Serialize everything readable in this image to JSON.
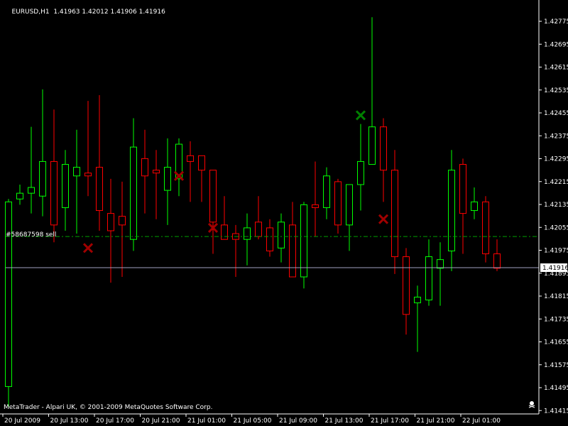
{
  "window": {
    "title_parts": [
      "EURUSD,H1",
      "1.41963",
      "1.42012",
      "1.41906",
      "1.41916"
    ],
    "copyright": "MetaTrader - Alpari UK, © 2001-2009 MetaQuotes Software Corp.",
    "order_label": "#58687598 sell",
    "current_price_label": "1.41916"
  },
  "colors": {
    "background": "#000000",
    "axis": "#ffffff",
    "bull": "#00ff00",
    "bear": "#ff0000",
    "bull_marker": "#008000",
    "bear_marker": "#a00000",
    "order_line": "#00a000",
    "price_line": "#a0a0c0"
  },
  "chart_data": {
    "type": "candlestick",
    "symbol": "EURUSD",
    "timeframe": "H1",
    "ylim": [
      1.4141,
      1.4282
    ],
    "y_ticks": [
      "1.42775",
      "1.42695",
      "1.42615",
      "1.42535",
      "1.42455",
      "1.42375",
      "1.42295",
      "1.42215",
      "1.42135",
      "1.42055",
      "1.41975",
      "1.41895",
      "1.41815",
      "1.41735",
      "1.41655",
      "1.41575",
      "1.41495",
      "1.41415"
    ],
    "x_tick_labels": [
      "20 Jul 2009",
      "20 Jul 13:00",
      "20 Jul 17:00",
      "20 Jul 21:00",
      "21 Jul 01:00",
      "21 Jul 05:00",
      "21 Jul 09:00",
      "21 Jul 13:00",
      "21 Jul 17:00",
      "21 Jul 21:00",
      "22 Jul 01:00"
    ],
    "candles": [
      {
        "o": 1.415,
        "h": 1.4215,
        "l": 1.4143,
        "c": 1.4214
      },
      {
        "o": 1.4215,
        "h": 1.422,
        "l": 1.4213,
        "c": 1.4217
      },
      {
        "o": 1.4217,
        "h": 1.424,
        "l": 1.421,
        "c": 1.4219
      },
      {
        "o": 1.4216,
        "h": 1.4253,
        "l": 1.4209,
        "c": 1.4228
      },
      {
        "o": 1.4228,
        "h": 1.4246,
        "l": 1.42,
        "c": 1.4206
      },
      {
        "o": 1.4212,
        "h": 1.4232,
        "l": 1.4204,
        "c": 1.4227
      },
      {
        "o": 1.4223,
        "h": 1.4239,
        "l": 1.4203,
        "c": 1.4226
      },
      {
        "o": 1.4224,
        "h": 1.4249,
        "l": 1.4216,
        "c": 1.4223
      },
      {
        "o": 1.4226,
        "h": 1.4251,
        "l": 1.4204,
        "c": 1.4211
      },
      {
        "o": 1.421,
        "h": 1.4222,
        "l": 1.4186,
        "c": 1.4204
      },
      {
        "o": 1.4209,
        "h": 1.4221,
        "l": 1.4188,
        "c": 1.4206
      },
      {
        "o": 1.4201,
        "h": 1.4243,
        "l": 1.4197,
        "c": 1.4233
      },
      {
        "o": 1.4229,
        "h": 1.4239,
        "l": 1.421,
        "c": 1.4223
      },
      {
        "o": 1.4225,
        "h": 1.4232,
        "l": 1.4208,
        "c": 1.4224
      },
      {
        "o": 1.4218,
        "h": 1.4236,
        "l": 1.4206,
        "c": 1.4226
      },
      {
        "o": 1.4222,
        "h": 1.4236,
        "l": 1.4216,
        "c": 1.4234
      },
      {
        "o": 1.423,
        "h": 1.4235,
        "l": 1.4214,
        "c": 1.4228
      },
      {
        "o": 1.423,
        "h": 1.4226,
        "l": 1.4214,
        "c": 1.4225
      },
      {
        "o": 1.4225,
        "h": 1.4223,
        "l": 1.4196,
        "c": 1.4207
      },
      {
        "o": 1.4206,
        "h": 1.4216,
        "l": 1.4203,
        "c": 1.4201
      },
      {
        "o": 1.4203,
        "h": 1.4206,
        "l": 1.4188,
        "c": 1.4201
      },
      {
        "o": 1.4201,
        "h": 1.421,
        "l": 1.4192,
        "c": 1.4205
      },
      {
        "o": 1.4207,
        "h": 1.4216,
        "l": 1.4201,
        "c": 1.4202
      },
      {
        "o": 1.4205,
        "h": 1.4208,
        "l": 1.4195,
        "c": 1.4197
      },
      {
        "o": 1.4198,
        "h": 1.421,
        "l": 1.4193,
        "c": 1.4207
      },
      {
        "o": 1.4206,
        "h": 1.4214,
        "l": 1.419,
        "c": 1.4188
      },
      {
        "o": 1.4188,
        "h": 1.4214,
        "l": 1.4184,
        "c": 1.4213
      },
      {
        "o": 1.4213,
        "h": 1.4228,
        "l": 1.4202,
        "c": 1.4212
      },
      {
        "o": 1.4212,
        "h": 1.4226,
        "l": 1.4208,
        "c": 1.4223
      },
      {
        "o": 1.4221,
        "h": 1.4222,
        "l": 1.4203,
        "c": 1.4206
      },
      {
        "o": 1.4206,
        "h": 1.4218,
        "l": 1.4197,
        "c": 1.422
      },
      {
        "o": 1.422,
        "h": 1.4241,
        "l": 1.4211,
        "c": 1.4228
      },
      {
        "o": 1.4227,
        "h": 1.4278,
        "l": 1.4227,
        "c": 1.424
      },
      {
        "o": 1.424,
        "h": 1.4243,
        "l": 1.4214,
        "c": 1.4225
      },
      {
        "o": 1.4225,
        "h": 1.4232,
        "l": 1.4189,
        "c": 1.4195
      },
      {
        "o": 1.4195,
        "h": 1.4198,
        "l": 1.4168,
        "c": 1.4175
      },
      {
        "o": 1.4179,
        "h": 1.4185,
        "l": 1.4162,
        "c": 1.4181
      },
      {
        "o": 1.418,
        "h": 1.4201,
        "l": 1.4178,
        "c": 1.4195
      },
      {
        "o": 1.4191,
        "h": 1.42,
        "l": 1.4178,
        "c": 1.4194
      },
      {
        "o": 1.4197,
        "h": 1.4232,
        "l": 1.419,
        "c": 1.4225
      },
      {
        "o": 1.4227,
        "h": 1.4229,
        "l": 1.4196,
        "c": 1.421
      },
      {
        "o": 1.4211,
        "h": 1.4219,
        "l": 1.4208,
        "c": 1.4214
      },
      {
        "o": 1.4214,
        "h": 1.4216,
        "l": 1.4193,
        "c": 1.4196
      },
      {
        "o": 1.4196,
        "h": 1.4201,
        "l": 1.419,
        "c": 1.4191
      }
    ],
    "trade_markers": [
      {
        "candle": 7,
        "price": 1.4198,
        "side": "sell"
      },
      {
        "candle": 15,
        "price": 1.4223,
        "side": "sell"
      },
      {
        "candle": 18,
        "price": 1.4205,
        "side": "sell"
      },
      {
        "candle": 31,
        "price": 1.4244,
        "side": "buy"
      },
      {
        "candle": 33,
        "price": 1.4208,
        "side": "sell"
      }
    ],
    "order_price": 1.4202,
    "current_price": 1.41916
  }
}
